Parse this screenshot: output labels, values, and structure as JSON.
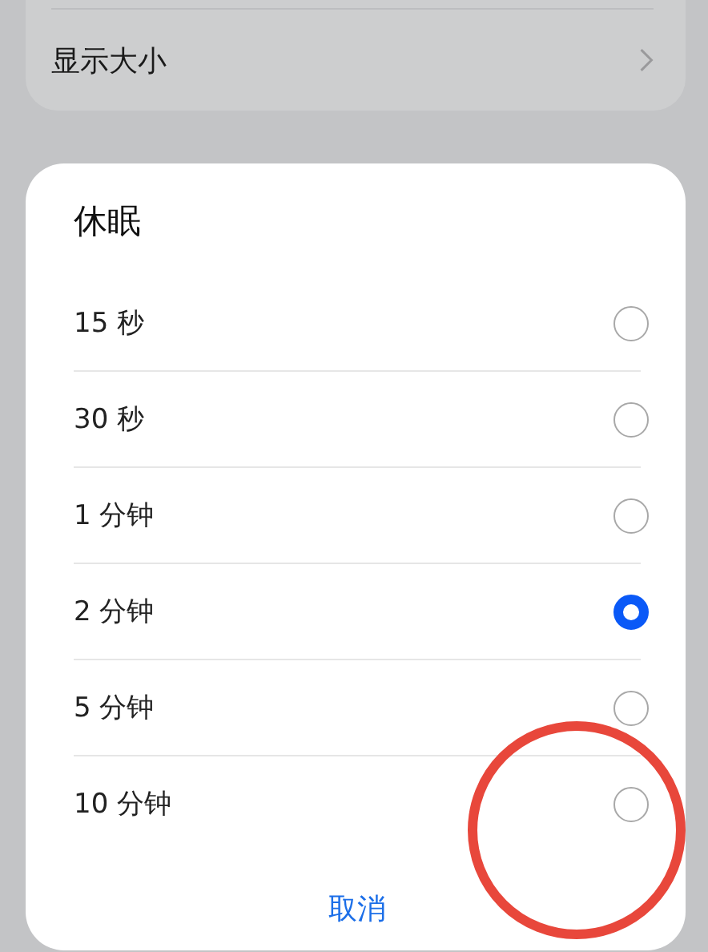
{
  "settings_list": [
    {
      "label": "显示大小",
      "chevron": true
    }
  ],
  "dialog": {
    "title": "休眠",
    "options": [
      {
        "label": "15 秒",
        "selected": false,
        "highlighted": false
      },
      {
        "label": "30 秒",
        "selected": false,
        "highlighted": false
      },
      {
        "label": "1 分钟",
        "selected": false,
        "highlighted": false
      },
      {
        "label": "2 分钟",
        "selected": true,
        "highlighted": false
      },
      {
        "label": "5 分钟",
        "selected": false,
        "highlighted": false
      },
      {
        "label": "10 分钟",
        "selected": false,
        "highlighted": true
      }
    ],
    "cancel_button": "取消"
  }
}
